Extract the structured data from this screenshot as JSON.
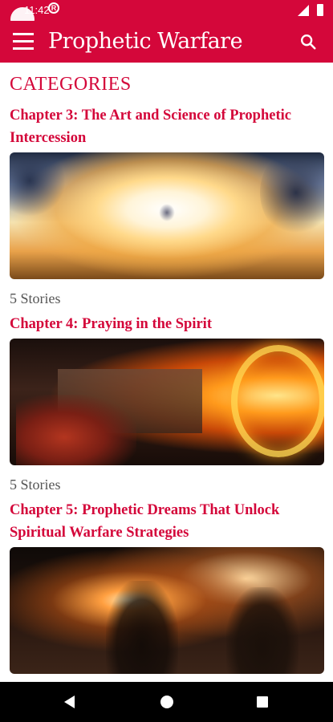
{
  "status_bar": {
    "time": "11:42"
  },
  "app_bar": {
    "title": "Prophetic Warfare"
  },
  "main": {
    "section_heading": "CATEGORIES",
    "chapters": [
      {
        "title": "Chapter 3: The Art and Science of Prophetic Intercession",
        "story_count": "5 Stories"
      },
      {
        "title": "Chapter 4: Praying in the Spirit",
        "story_count": "5 Stories"
      },
      {
        "title": "Chapter 5: Prophetic Dreams That Unlock Spiritual Warfare Strategies",
        "story_count": ""
      }
    ]
  },
  "colors": {
    "accent": "#d4073a",
    "nav_bar": "#000000"
  },
  "icons": {
    "menu": "menu-icon",
    "search": "search-icon",
    "back": "back-icon",
    "home": "home-icon",
    "recents": "recents-icon"
  }
}
